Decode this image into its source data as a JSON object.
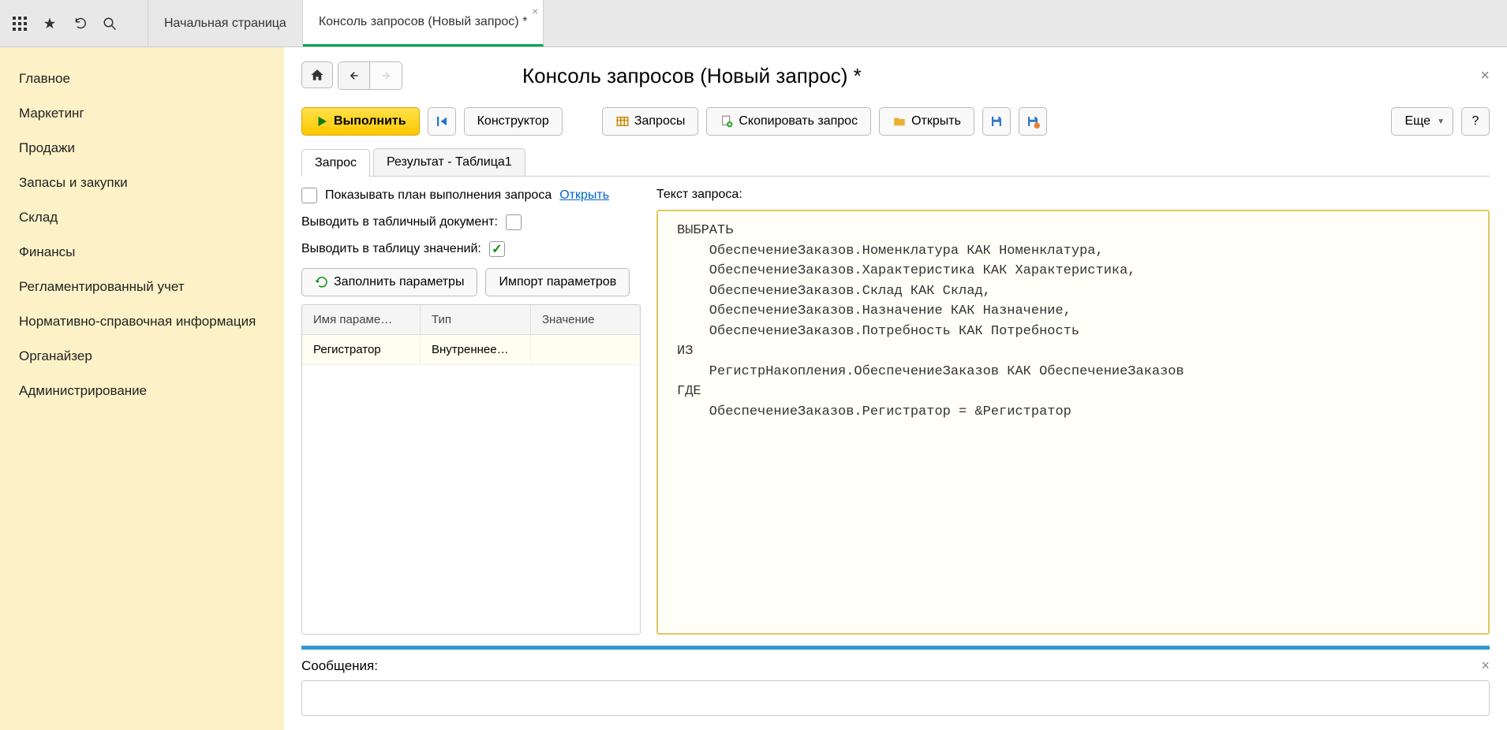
{
  "tabs": [
    {
      "label": "Начальная страница"
    },
    {
      "label": "Консоль запросов (Новый запрос) *"
    }
  ],
  "sidebar": {
    "items": [
      "Главное",
      "Маркетинг",
      "Продажи",
      "Запасы и закупки",
      "Склад",
      "Финансы",
      "Регламентированный учет",
      "Нормативно-справочная информация",
      "Органайзер",
      "Администрирование"
    ]
  },
  "page": {
    "title": "Консоль запросов (Новый запрос) *"
  },
  "toolbar": {
    "execute": "Выполнить",
    "constructor": "Конструктор",
    "queries": "Запросы",
    "copy_query": "Скопировать запрос",
    "open": "Открыть",
    "more": "Еще",
    "help": "?"
  },
  "subtabs": {
    "query": "Запрос",
    "result": "Результат - Таблица1"
  },
  "options": {
    "show_plan": "Показывать план выполнения запроса",
    "open_link": "Открыть",
    "output_tabular": "Выводить в табличный документ:",
    "output_table": "Выводить в таблицу значений:",
    "fill_params": "Заполнить параметры",
    "import_params": "Импорт параметров"
  },
  "param_table": {
    "headers": {
      "name": "Имя параме…",
      "type": "Тип",
      "value": "Значение"
    },
    "rows": [
      {
        "name": "Регистратор",
        "type": "Внутреннее…",
        "value": ""
      }
    ]
  },
  "query": {
    "label": "Текст запроса:",
    "text": "ВЫБРАТЬ\n    ОбеспечениеЗаказов.Номенклатура КАК Номенклатура,\n    ОбеспечениеЗаказов.Характеристика КАК Характеристика,\n    ОбеспечениеЗаказов.Склад КАК Склад,\n    ОбеспечениеЗаказов.Назначение КАК Назначение,\n    ОбеспечениеЗаказов.Потребность КАК Потребность\nИЗ\n    РегистрНакопления.ОбеспечениеЗаказов КАК ОбеспечениеЗаказов\nГДЕ\n    ОбеспечениеЗаказов.Регистратор = &Регистратор"
  },
  "messages": {
    "label": "Сообщения:"
  }
}
